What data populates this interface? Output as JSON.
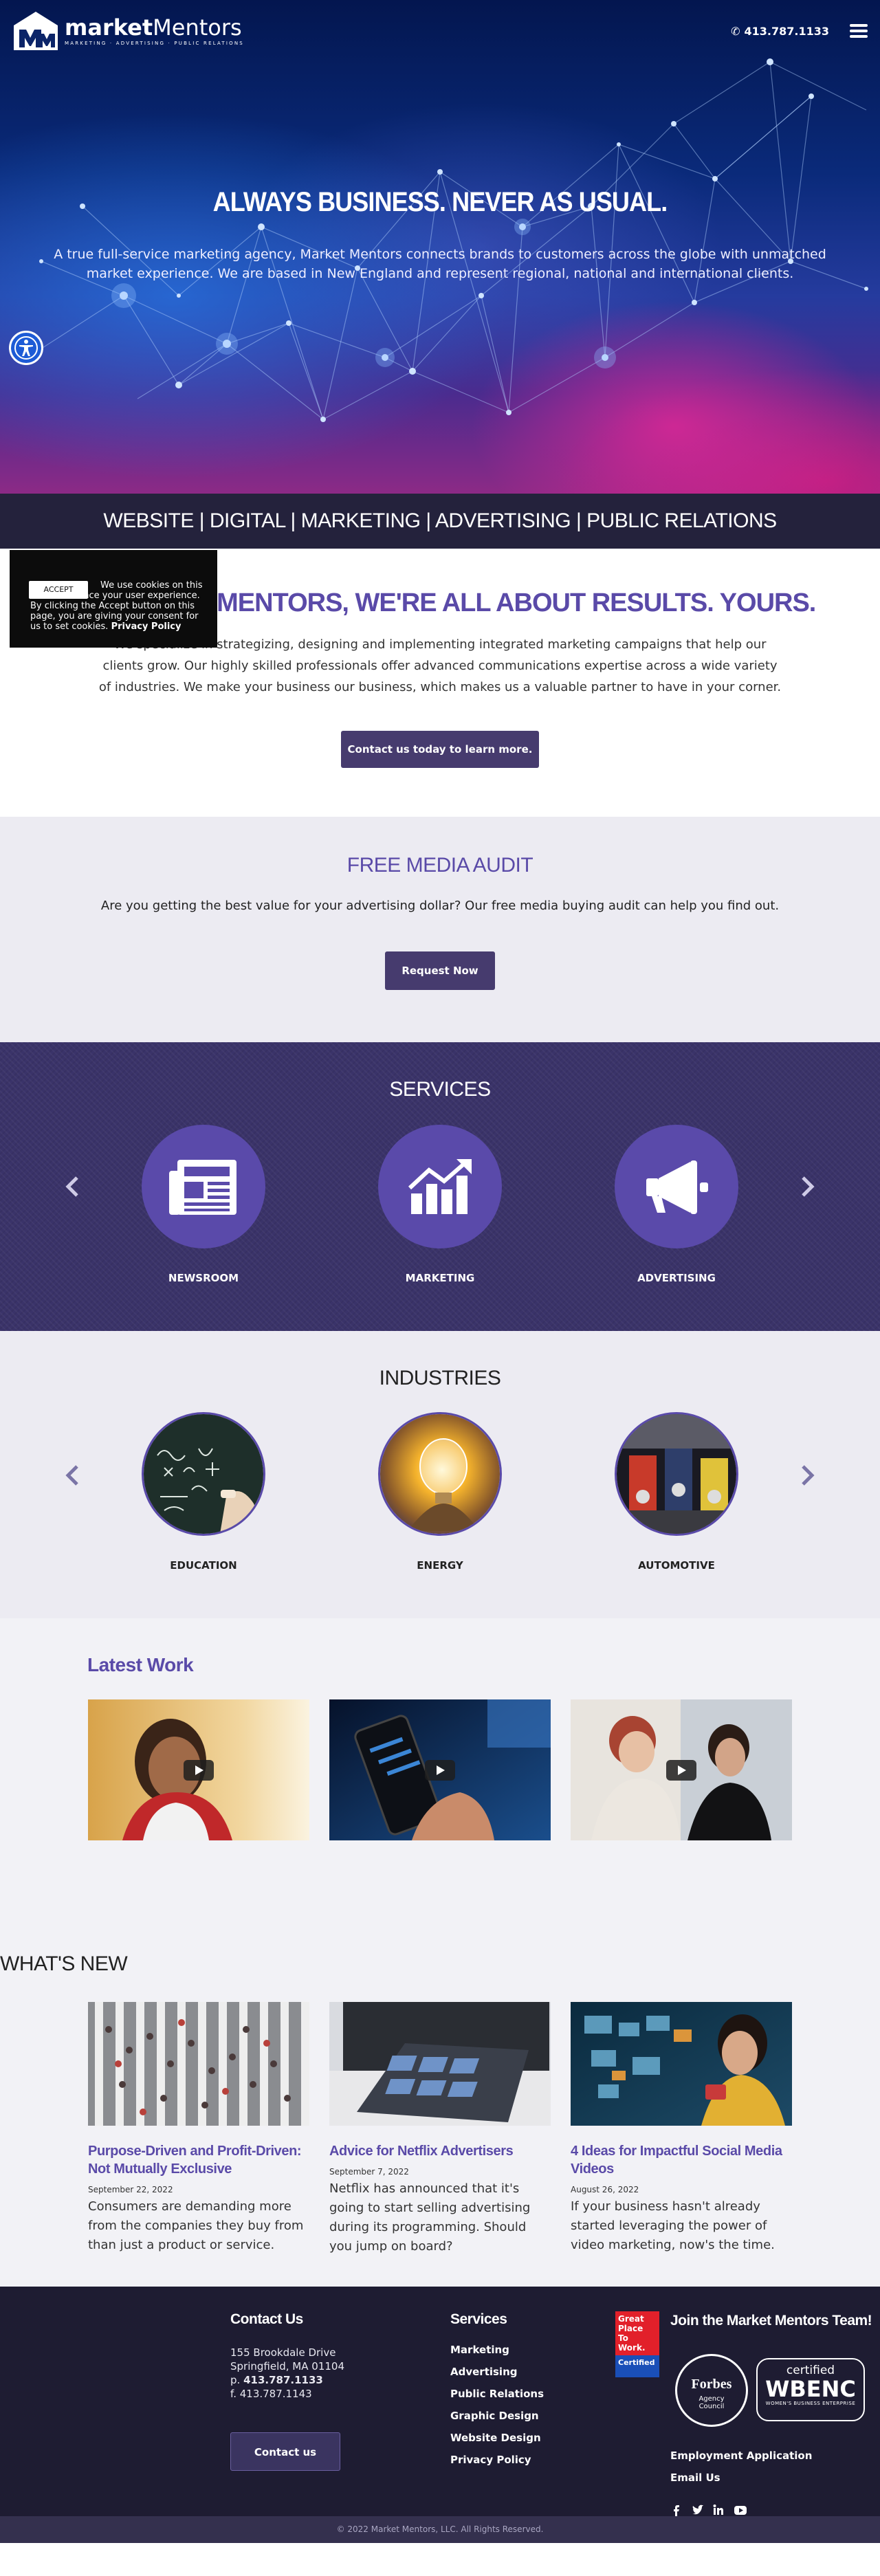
{
  "header": {
    "logo_name_1": "market",
    "logo_name_2": "Mentors",
    "logo_tagline": "MARKETING · ADVERTISING · PUBLIC RELATIONS",
    "phone": "413.787.1133"
  },
  "hero": {
    "title": "ALWAYS BUSINESS. NEVER AS USUAL.",
    "subtitle": "A true full-service marketing agency, Market Mentors connects brands to customers across the globe with unmatched market experience. We are based in New England and represent regional, national and international clients."
  },
  "strip": {
    "text": "WEBSITE | DIGITAL | MARKETING | ADVERTISING | PUBLIC RELATIONS"
  },
  "results": {
    "heading": "AT MARKET MENTORS, WE'RE ALL ABOUT RESULTS. YOURS.",
    "body": "We specialize in strategizing, designing and implementing integrated marketing campaigns that help our clients grow. Our highly skilled professionals offer advanced communications expertise across a wide variety of industries. We make your business our business, which makes us a valuable partner to have in your corner.",
    "button": "Contact us today to learn more."
  },
  "cookie": {
    "accept": "ACCEPT",
    "text": "We use cookies on this site to enhance your user experience. By clicking the Accept button on this page, you are giving your consent for us to set cookies.",
    "policy": "Privacy Policy"
  },
  "audit": {
    "heading": "FREE MEDIA AUDIT",
    "body": "Are you getting the best value for your advertising dollar? Our free media buying audit can help you find out.",
    "button": "Request Now"
  },
  "services": {
    "heading": "SERVICES",
    "items": [
      {
        "label": "NEWSROOM",
        "icon": "newspaper-icon"
      },
      {
        "label": "MARKETING",
        "icon": "chart-growth-icon"
      },
      {
        "label": "ADVERTISING",
        "icon": "megaphone-icon"
      }
    ]
  },
  "industries": {
    "heading": "INDUSTRIES",
    "items": [
      {
        "label": "EDUCATION"
      },
      {
        "label": "ENERGY"
      },
      {
        "label": "AUTOMOTIVE"
      }
    ]
  },
  "latest": {
    "heading": "Latest Work"
  },
  "news": {
    "heading": "WHAT'S NEW",
    "posts": [
      {
        "title": "Purpose-Driven and Profit-Driven: Not Mutually Exclusive",
        "date": "September 22, 2022",
        "excerpt": "Consumers are demanding more from the companies they buy from than just a product or service."
      },
      {
        "title": "Advice for Netflix Advertisers",
        "date": "September 7, 2022",
        "excerpt": "Netflix has announced that it's going to start selling advertising during its programming. Should you jump on board?"
      },
      {
        "title": "4 Ideas for Impactful Social Media Videos",
        "date": "August 26, 2022",
        "excerpt": "If your business hasn't already started leveraging the power of video marketing, now's the time."
      }
    ]
  },
  "footer": {
    "contact_heading": "Contact Us",
    "address1": "155 Brookdale Drive",
    "address2": "Springfield, MA 01104",
    "phone_prefix": "p.",
    "phone": "413.787.1133",
    "fax": "f. 413.787.1143",
    "contact_button": "Contact us",
    "services_heading": "Services",
    "services_links": [
      "Marketing",
      "Advertising",
      "Public Relations",
      "Graphic Design",
      "Website Design",
      "Privacy Policy"
    ],
    "join_heading": "Join the Market Mentors Team!",
    "gptw": [
      "Great",
      "Place",
      "To",
      "Work.",
      "Certified"
    ],
    "forbes": {
      "title": "Forbes",
      "sub1": "Agency",
      "sub2": "Council"
    },
    "wbenc": {
      "top": "certified",
      "name": "WBENC",
      "sub": "WOMEN'S BUSINESS ENTERPRISE"
    },
    "links": [
      "Employment Application",
      "Email Us"
    ],
    "copyright": "© 2022 Market Mentors, LLC. All Rights Reserved."
  }
}
